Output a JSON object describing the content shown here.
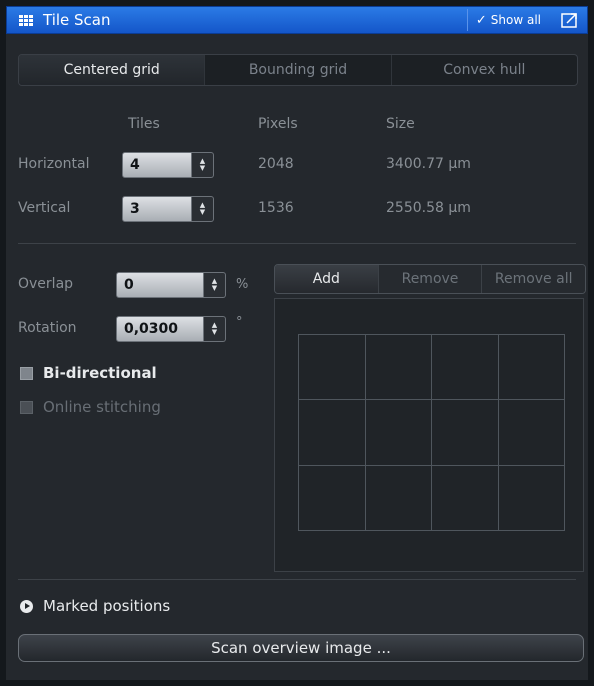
{
  "header": {
    "title": "Tile Scan",
    "show_all_label": "Show all",
    "colors": {
      "title_bar": "#1c66db",
      "panel_bg": "#24282d"
    }
  },
  "tabs": [
    {
      "label": "Centered grid",
      "active": true
    },
    {
      "label": "Bounding grid",
      "active": false
    },
    {
      "label": "Convex hull",
      "active": false
    }
  ],
  "grid_table": {
    "columns": [
      "Tiles",
      "Pixels",
      "Size"
    ],
    "rows": [
      {
        "label": "Horizontal",
        "tiles": "4",
        "pixels": "2048",
        "size": "3400.77 µm"
      },
      {
        "label": "Vertical",
        "tiles": "3",
        "pixels": "1536",
        "size": "2550.58 µm"
      }
    ]
  },
  "overlap": {
    "label": "Overlap",
    "value": "0",
    "unit": "%"
  },
  "rotation": {
    "label": "Rotation",
    "value": "0,0300",
    "unit": "°"
  },
  "options": {
    "bidirectional": {
      "label": "Bi-directional",
      "enabled": true
    },
    "online_stitching": {
      "label": "Online stitching",
      "enabled": false
    }
  },
  "positions_buttons": {
    "add": "Add",
    "remove": "Remove",
    "remove_all": "Remove all"
  },
  "tile_preview": {
    "columns": 4,
    "rows": 3
  },
  "marked_positions_label": "Marked positions",
  "scan_overview_label": "Scan overview image ..."
}
